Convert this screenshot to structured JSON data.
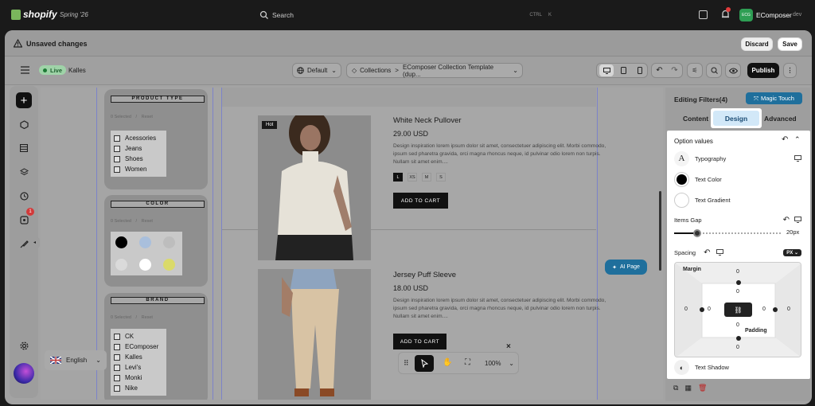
{
  "topbar": {
    "brand": "shopify",
    "edition": "Spring '26",
    "search_placeholder": "Search",
    "shortcut_ctrl": "CTRL",
    "shortcut_key": "K",
    "store_initials": "ECG",
    "store_name": "EComposer",
    "store_tag": "dev"
  },
  "unsaved": {
    "message": "Unsaved changes",
    "discard": "Discard",
    "save": "Save"
  },
  "toolbar": {
    "live_badge": "Live",
    "theme_name": "Kalles",
    "default_label": "Default",
    "breadcrumb_collections": "Collections",
    "breadcrumb_sep": ">",
    "template_name": "EComposer Collection Template (dup...",
    "publish": "Publish"
  },
  "leftnav": {
    "notification_count": "1"
  },
  "filters": {
    "product_type": {
      "title": "PRODUCT TYPE",
      "selected": "0 Selected",
      "sep": "/",
      "reset": "Reset",
      "items": [
        "Acessories",
        "Jeans",
        "Shoes",
        "Women"
      ]
    },
    "color": {
      "title": "COLOR",
      "selected": "0 Selected",
      "sep": "/",
      "reset": "Reset",
      "swatches": [
        "#000000",
        "#a9bfdc",
        "#bdbdbd",
        "#dadada",
        "#ffffff",
        "#dada6a"
      ]
    },
    "brand": {
      "title": "BRAND",
      "selected": "0 Selected",
      "sep": "/",
      "reset": "Reset",
      "items": [
        "CK",
        "EComposer",
        "Kalles",
        "Levi's",
        "Monki",
        "Nike"
      ]
    }
  },
  "products": [
    {
      "badge": "Hot",
      "title": "White Neck Pullover",
      "price": "29.00 USD",
      "desc1": "Design inspiration lorem ipsum dolor sit amet, consectetuer adipiscing elit. Morbi commodo,",
      "desc2": "ipsum sed pharetra gravida, orci magna rhoncus neque, id pulvinar odio lorem non turpis.",
      "desc3": "Nullam sit amet enim....",
      "sizes": [
        "L",
        "XS",
        "M",
        "S"
      ],
      "cta": "ADD TO CART"
    },
    {
      "title": "Jersey Puff Sleeve",
      "price": "18.00 USD",
      "desc1": "Design inspiration lorem ipsum dolor sit amet, consectetuer adipiscing elit. Morbi commodo,",
      "desc2": "ipsum sed pharetra gravida, orci magna rhoncus neque, id pulvinar odio lorem non turpis.",
      "desc3": "Nullam sit amet enim....",
      "cta": "ADD TO CART"
    }
  ],
  "language": {
    "label": "English"
  },
  "ai_page": {
    "label": "AI Page"
  },
  "bottom_tool": {
    "zoom": "100%",
    "close": "×"
  },
  "rpanel": {
    "title": "Editing Filters(4)",
    "magic": "Magic Touch",
    "tabs": [
      "Content",
      "Design",
      "Advanced"
    ],
    "active_tab": "Design",
    "option_values": "Option values",
    "typography": "Typography",
    "text_color": "Text Color",
    "text_color_value": "#000000",
    "text_gradient": "Text Gradient",
    "items_gap": "Items Gap",
    "items_gap_value": "20px",
    "items_gap_fraction": 0.22,
    "spacing": "Spacing",
    "unit": "PX",
    "margin": "Margin",
    "padding": "Padding",
    "margin_top": "0",
    "margin_bottom": "0",
    "margin_left": "0",
    "margin_right": "0",
    "padding_top": "0",
    "padding_bottom": "0",
    "padding_left": "0",
    "padding_right": "0",
    "text_shadow": "Text Shadow"
  }
}
